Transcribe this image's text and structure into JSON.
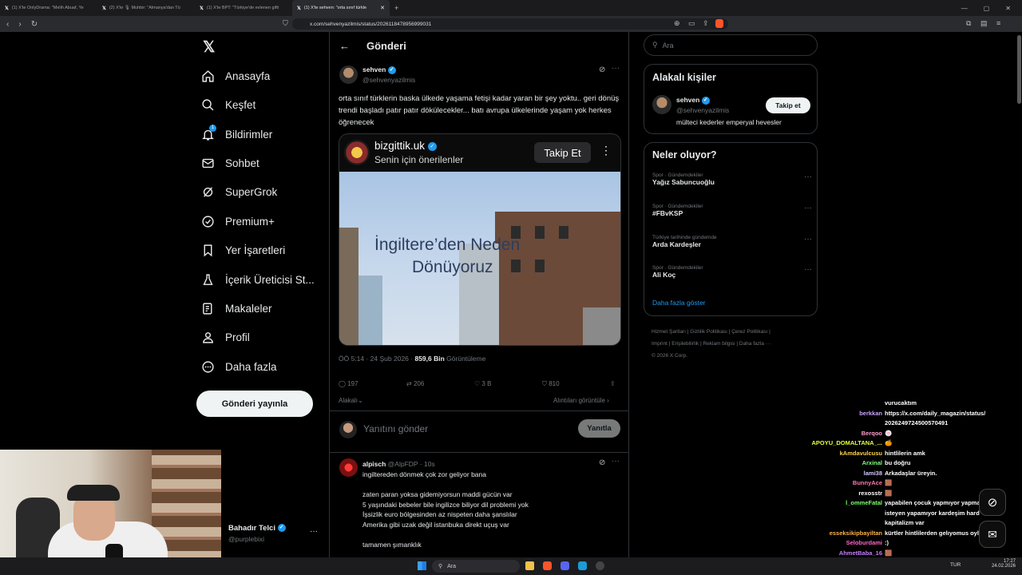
{
  "browser": {
    "tabs": [
      {
        "label": "(1) X'te OnlyDrama: \"Melih Abuaf, Ye"
      },
      {
        "label": "(2) X'te 🎙 Muhbir: \"Almanya'dan Tü"
      },
      {
        "label": "(1) X'te BPT: \"Türkiye'de evlenen gifti"
      },
      {
        "label": "(1) X'te sehven: \"orta sınıf türkle"
      }
    ],
    "url": "x.com/sehvenyazilmis/status/2026118478956999031"
  },
  "nav": {
    "items": [
      {
        "label": "Anasayfa"
      },
      {
        "label": "Keşfet"
      },
      {
        "label": "Bildirimler"
      },
      {
        "label": "Sohbet"
      },
      {
        "label": "SuperGrok"
      },
      {
        "label": "Premium+"
      },
      {
        "label": "Yer İşaretleri"
      },
      {
        "label": "İçerik Üreticisi St..."
      },
      {
        "label": "Makaleler"
      },
      {
        "label": "Profil"
      },
      {
        "label": "Daha fazla"
      }
    ],
    "notif_badge": "1",
    "post_button": "Gönderi yayınla",
    "account": {
      "name": "Bahadır Telci",
      "handle": "@purplebixi"
    }
  },
  "center": {
    "header": "Gönderi",
    "post": {
      "author": "sehven",
      "handle": "@sehvenyazilmis",
      "text": "orta sınıf türklerin baska ülkede yaşama fetişi kadar yaran bir şey yoktu.. geri dönüş trendi başladı patır patır dökülecekler... batı avrupa ülkelerinde yaşam yok herkes öğrenecek",
      "embed": {
        "account": "bizgittik.uk",
        "subtitle": "Senin için önerilenler",
        "follow": "Takip Et",
        "image_text_1": "İngiltere’den Neden",
        "image_text_2": "Dönüyoruz"
      },
      "time": "ÖÖ 5:14 · 24 Şub 2026 ·",
      "views": "859,6 Bin",
      "views_label": "Görüntüleme",
      "replies": "197",
      "reposts": "206",
      "likes": "3 B",
      "bookmarks": "810",
      "sort_label": "Alakalı",
      "quotes_label": "Alıntıları görüntüle"
    },
    "reply_box": {
      "placeholder": "Yanıtını gönder",
      "button": "Yanıtla"
    },
    "reply": {
      "author": "alpisch",
      "handle": "@AlpFDP · 10s",
      "lines": [
        "ingiltereden dönmek çok zor geliyor bana",
        "zaten paran yoksa gidemiyorsun maddi gücün var",
        "5 yaşındaki bebeler bile ingilizce biliyor dil problemi yok",
        "İşsizlik euro bölgesinden az nispeten daha şanslılar",
        "Amerika gibi uzak değil istanbuka direkt uçuş var",
        "tamamen şımanklık"
      ]
    }
  },
  "right": {
    "search_placeholder": "Ara",
    "related": {
      "title": "Alakalı kişiler",
      "name": "sehven",
      "handle": "@sehvenyazilmis",
      "bio": "mülteci kederler emperyal hevesler",
      "follow": "Takip et"
    },
    "trends": {
      "title": "Neler oluyor?",
      "items": [
        {
          "category": "Spor · Gündemdekiler",
          "name": "Yağız Sabuncuoğlu"
        },
        {
          "category": "Spor · Gündemdekiler",
          "name": "#FBvKSP"
        },
        {
          "category": "Türkiye tarihinde gündemde",
          "name": "Arda Kardeşler"
        },
        {
          "category": "Spor · Gündemdekiler",
          "name": "Ali Koç"
        }
      ],
      "more": "Daha fazla göster"
    },
    "footer": {
      "line1": [
        "Hizmet Şartları",
        "Gizlilik Politikası",
        "Çerez Politikası"
      ],
      "line2": [
        "Imprint",
        "Erişilebilirlik",
        "Reklam bilgisi",
        "Daha fazla ···"
      ],
      "copyright": "© 2026 X Corp."
    }
  },
  "chat": {
    "lines": [
      {
        "user": "",
        "msg": "vurucaktım",
        "color": "#ffffff"
      },
      {
        "user": "berkkan",
        "msg": "https://x.com/daily_magazin/status/",
        "color": "#c9a4ff"
      },
      {
        "user": "",
        "msg": "2026249724500570491",
        "color": "#ffffff"
      },
      {
        "user": "Berqoo",
        "msg": "🍥",
        "color": "#ff9ec9"
      },
      {
        "user": "APOYU_DOMALTANA_...",
        "msg": "🍊",
        "color": "#e6ff3d"
      },
      {
        "user": "kAmdavulcusu",
        "msg": "hintlilerin amk",
        "color": "#ffd44a"
      },
      {
        "user": "Arxinal",
        "msg": "bu doğru",
        "color": "#7cff7c"
      },
      {
        "user": "lami38",
        "msg": "Arkadaşlar üreyin.",
        "color": "#d6c9ff"
      },
      {
        "user": "BunnyAce",
        "msg": "🟫",
        "color": "#ff7ab6"
      },
      {
        "user": "rexosstr",
        "msg": "🟫",
        "color": "#ffffff"
      },
      {
        "user": "l_ommeFatal",
        "msg": "yapabilen çocuk yapmıyor yapmak",
        "color": "#7dff6e"
      },
      {
        "user": "",
        "msg": "isteyen yapamıyor kardeşim hard",
        "color": "#ffffff"
      },
      {
        "user": "",
        "msg": "kapitalizm var",
        "color": "#ffffff"
      },
      {
        "user": "esseksikipbayiltan",
        "msg": "kürtler hintlilerden gelıyomus oyle mı",
        "color": "#ffb347"
      },
      {
        "user": "Seloburdami",
        "msg": ":)",
        "color": "#ff66cc"
      },
      {
        "user": "AhmetBaba_16",
        "msg": "🟫",
        "color": "#c77dff"
      }
    ]
  },
  "taskbar": {
    "search": "Ara",
    "lang": "TUR",
    "time": "17:27",
    "date": "24.02.2026"
  },
  "colors": {
    "accent": "#1d9bf0",
    "bg": "#000000",
    "border": "#2f3336"
  }
}
